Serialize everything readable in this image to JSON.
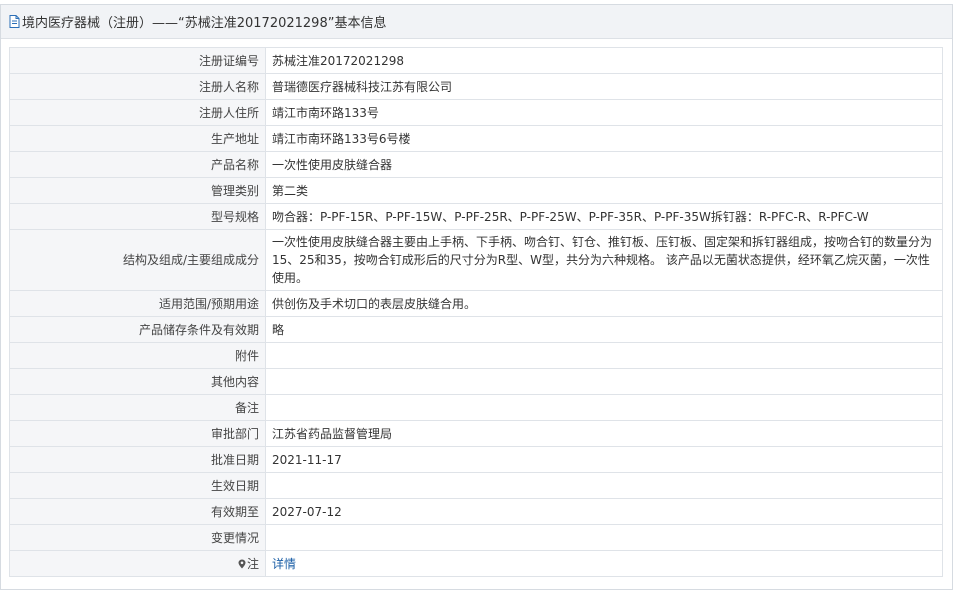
{
  "header": {
    "title": "境内医疗器械（注册）——“苏械注准20172021298”基本信息",
    "icon": "document-icon"
  },
  "rows": [
    {
      "label": "注册证编号",
      "value": "苏械注准20172021298"
    },
    {
      "label": "注册人名称",
      "value": "普瑞德医疗器械科技江苏有限公司"
    },
    {
      "label": "注册人住所",
      "value": "靖江市南环路133号"
    },
    {
      "label": "生产地址",
      "value": "靖江市南环路133号6号楼"
    },
    {
      "label": "产品名称",
      "value": "一次性使用皮肤缝合器"
    },
    {
      "label": "管理类别",
      "value": "第二类"
    },
    {
      "label": "型号规格",
      "value": "吻合器：P-PF-15R、P-PF-15W、P-PF-25R、P-PF-25W、P-PF-35R、P-PF-35W拆钉器：R-PFC-R、R-PFC-W"
    },
    {
      "label": "结构及组成/主要组成成分",
      "value": "一次性使用皮肤缝合器主要由上手柄、下手柄、吻合钉、钉仓、推钉板、压钉板、固定架和拆钉器组成，按吻合钉的数量分为15、25和35，按吻合钉成形后的尺寸分为R型、W型，共分为六种规格。 该产品以无菌状态提供，经环氧乙烷灭菌，一次性使用。"
    },
    {
      "label": "适用范围/预期用途",
      "value": "供创伤及手术切口的表层皮肤缝合用。"
    },
    {
      "label": "产品储存条件及有效期",
      "value": "略"
    },
    {
      "label": "附件",
      "value": ""
    },
    {
      "label": "其他内容",
      "value": ""
    },
    {
      "label": "备注",
      "value": ""
    },
    {
      "label": "审批部门",
      "value": "江苏省药品监督管理局"
    },
    {
      "label": "批准日期",
      "value": "2021-11-17"
    },
    {
      "label": "生效日期",
      "value": ""
    },
    {
      "label": "有效期至",
      "value": "2027-07-12"
    },
    {
      "label": "变更情况",
      "value": ""
    }
  ],
  "note_row": {
    "label": "注",
    "icon": "pin-icon",
    "link_text": "详情",
    "link_color": "#1a5ea6"
  }
}
